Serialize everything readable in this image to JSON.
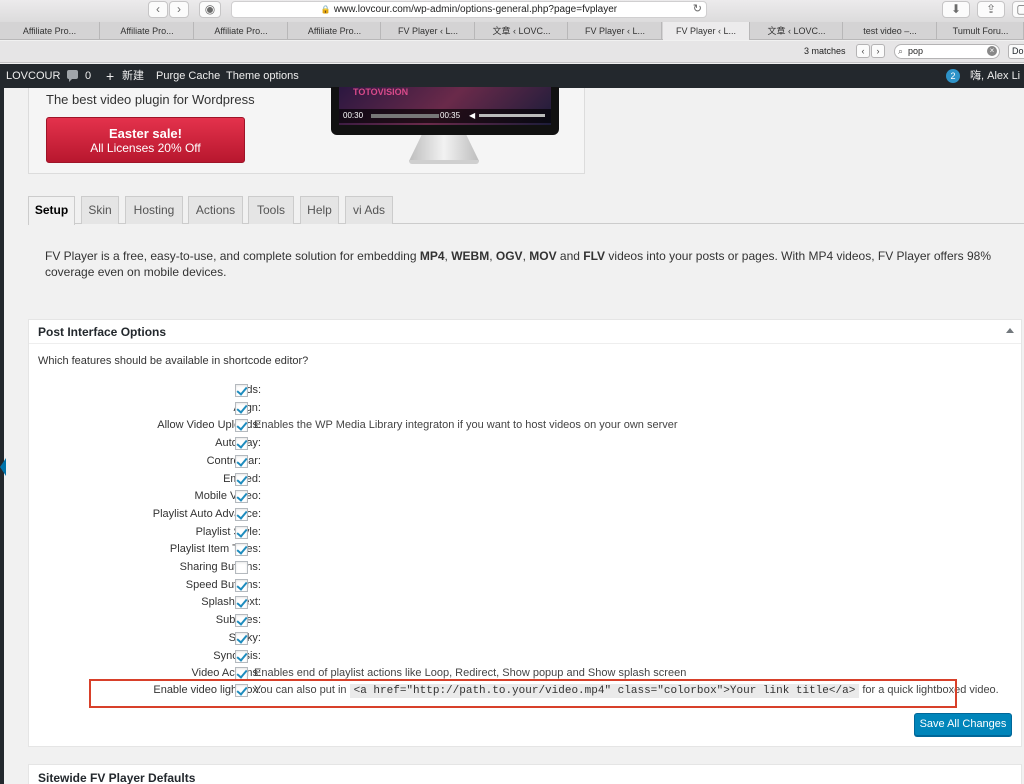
{
  "browser": {
    "url": "www.lovcour.com/wp-admin/options-general.php?page=fvplayer",
    "tabs": [
      "Affiliate Pro...",
      "Affiliate Pro...",
      "Affiliate Pro...",
      "Affiliate Pro...",
      "FV Player ‹ L...",
      "文章 ‹ LOVC...",
      "FV Player ‹ L...",
      "FV Player ‹ L...",
      "文章 ‹ LOVC...",
      "test video –...",
      "Tumult Foru..."
    ],
    "find": {
      "matches": "3 matches",
      "query": "pop",
      "done_label": "Do"
    }
  },
  "adminbar": {
    "site_name": "LOVCOUR",
    "comments_count": "0",
    "new_label": "新建",
    "purge_label": "Purge Cache",
    "theme_label": "Theme options",
    "updates_count": "2",
    "greeting": "嗨, Alex Li"
  },
  "promo": {
    "tagline": "The best video plugin for Wordpress",
    "sale_title": "Easter sale!",
    "sale_subtitle": "All Licenses 20% Off",
    "player_brand": "TOTOVISION",
    "time_current": "00:30",
    "time_total": "00:35"
  },
  "tabs": [
    "Setup",
    "Skin",
    "Hosting",
    "Actions",
    "Tools",
    "Help",
    "vi Ads"
  ],
  "intro": {
    "p1": "FV Player is a free, easy-to-use, and complete solution for embedding ",
    "f1": "MP4",
    "s1": ", ",
    "f2": "WEBM",
    "s2": ", ",
    "f3": "OGV",
    "s3": ", ",
    "f4": "MOV",
    "s4": " and ",
    "f5": "FLV",
    "p2": " videos into your posts or pages. With MP4 videos, FV Player offers 98% coverage even on mobile devices."
  },
  "postbox": {
    "title": "Post Interface Options",
    "question": "Which features should be available in shortcode editor?",
    "options": [
      {
        "label": "Ads:",
        "checked": true,
        "desc": ""
      },
      {
        "label": "Align:",
        "checked": true,
        "desc": ""
      },
      {
        "label": "Allow Video Uploads:",
        "checked": true,
        "desc": "Enables the WP Media Library integraton if you want to host videos on your own server"
      },
      {
        "label": "Autoplay:",
        "checked": true,
        "desc": ""
      },
      {
        "label": "Controlbar:",
        "checked": true,
        "desc": ""
      },
      {
        "label": "Embed:",
        "checked": true,
        "desc": ""
      },
      {
        "label": "Mobile Video:",
        "checked": true,
        "desc": ""
      },
      {
        "label": "Playlist Auto Advance:",
        "checked": true,
        "desc": ""
      },
      {
        "label": "Playlist Style:",
        "checked": true,
        "desc": ""
      },
      {
        "label": "Playlist Item Titles:",
        "checked": true,
        "desc": ""
      },
      {
        "label": "Sharing Buttons:",
        "checked": false,
        "desc": ""
      },
      {
        "label": "Speed Buttons:",
        "checked": true,
        "desc": ""
      },
      {
        "label": "Splash Text:",
        "checked": true,
        "desc": ""
      },
      {
        "label": "Subtitles:",
        "checked": true,
        "desc": ""
      },
      {
        "label": "Sticky:",
        "checked": true,
        "desc": ""
      },
      {
        "label": "Synopsis:",
        "checked": true,
        "desc": ""
      },
      {
        "label": "Video Actions:",
        "checked": true,
        "desc": "Enables end of playlist actions like Loop, Redirect, Show popup and Show splash screen"
      }
    ],
    "lightbox": {
      "label": "Enable video lightbox:",
      "checked": true,
      "desc_before": "You can also put in ",
      "code": "<a href=\"http://path.to.your/video.mp4\" class=\"colorbox\">Your link title</a>",
      "desc_after": " for a quick lightboxed video."
    },
    "save_label": "Save All Changes"
  },
  "postbox2": {
    "title": "Sitewide FV Player Defaults"
  },
  "colors": {
    "accent": "#0085ba",
    "sale": "#c91f37",
    "highlight": "#d8402a",
    "adminbar": "#23282d"
  }
}
